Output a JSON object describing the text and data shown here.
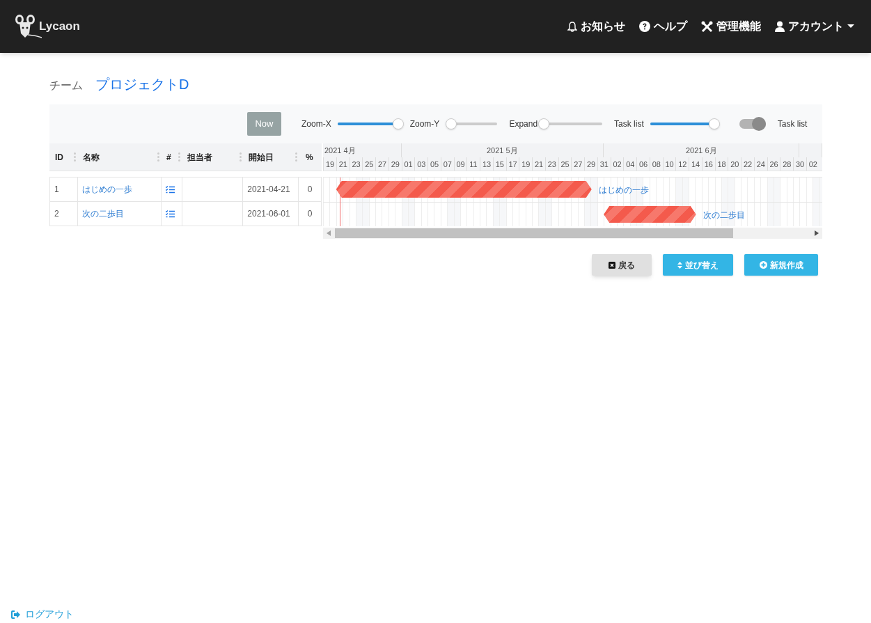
{
  "header": {
    "logo": "Lycaon",
    "nav": [
      {
        "kind": "bell",
        "label": "お知らせ"
      },
      {
        "kind": "help",
        "label": "ヘルプ"
      },
      {
        "kind": "tools",
        "label": "管理機能"
      },
      {
        "kind": "user",
        "label": "アカウント",
        "dropdown": true
      }
    ]
  },
  "breadcrumb": {
    "team_label": "チーム",
    "project": "プロジェクトD"
  },
  "toolbar": {
    "now_button": "Now",
    "sliders": [
      {
        "label": "Zoom-X",
        "level": 1
      },
      {
        "label": "Zoom-Y",
        "level": 0.1
      },
      {
        "label": "Expand",
        "level": 0
      },
      {
        "label": "Task list",
        "level": 1
      }
    ],
    "toggle": {
      "label": "Task list",
      "on": true
    }
  },
  "table": {
    "columns": [
      "ID",
      "名称",
      "#",
      "担当者",
      "開始日",
      "%"
    ],
    "rows": [
      {
        "id": "1",
        "name": "はじめの一歩",
        "task_list_icon": true,
        "start_date": "2021-04-21",
        "percent": "0",
        "bar_label": "はじめの一歩"
      },
      {
        "id": "2",
        "name": "次の二歩目",
        "task_list_icon": true,
        "start_date": "2021-06-01",
        "percent": "0",
        "bar_label": "次の二歩目"
      }
    ]
  },
  "timeline": {
    "months": [
      {
        "label": "2021 4月",
        "days": [
          "19",
          "21",
          "23",
          "25",
          "27",
          "29"
        ]
      },
      {
        "label": "2021 5月",
        "days": [
          "01",
          "03",
          "05",
          "07",
          "09",
          "11",
          "13",
          "15",
          "17",
          "19",
          "21",
          "23",
          "25",
          "27",
          "29",
          "31"
        ]
      },
      {
        "label": "2021 6月",
        "days": [
          "02",
          "04",
          "06",
          "08",
          "10",
          "12",
          "14",
          "16",
          "18",
          "20",
          "22",
          "24",
          "26",
          "28",
          "30"
        ]
      },
      {
        "days": [
          "02"
        ]
      }
    ]
  },
  "buttons": [
    {
      "kind": "back",
      "label": "戻る"
    },
    {
      "kind": "sort",
      "label": "並び替え"
    },
    {
      "kind": "new",
      "label": "新規作成"
    }
  ],
  "footer": {
    "logout": "ログアウト"
  }
}
